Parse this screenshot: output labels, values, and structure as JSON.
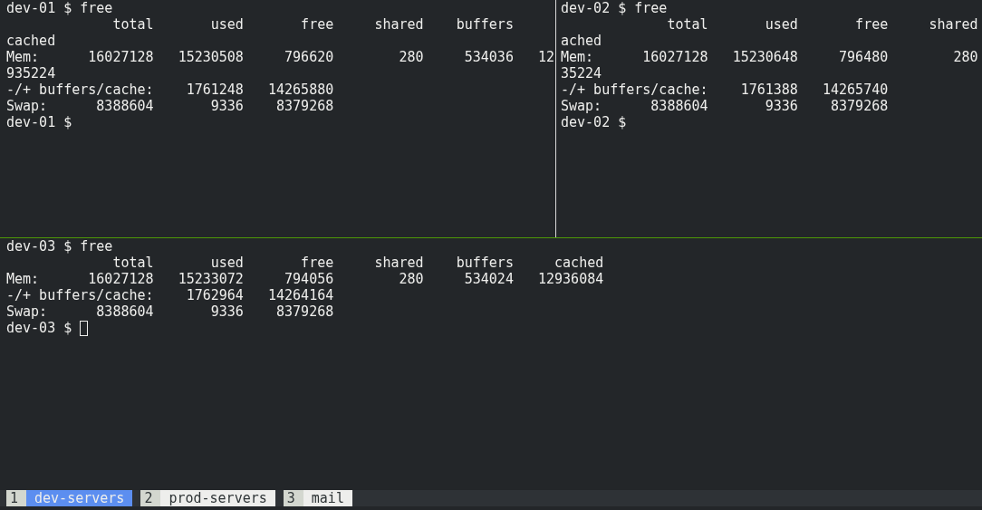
{
  "top_panes": [
    {
      "cursor": false,
      "lines": [
        "dev-01 $ free",
        "             total       used       free     shared    buffers",
        "cached",
        "Mem:      16027128   15230508     796620        280     534036   12",
        "935224",
        "-/+ buffers/cache:    1761248   14265880",
        "Swap:      8388604       9336    8379268",
        "dev-01 $ "
      ]
    },
    {
      "cursor": false,
      "lines": [
        "dev-02 $ free",
        "             total       used       free     shared",
        "ached",
        "Mem:      16027128   15230648     796480        280",
        "35224",
        "-/+ buffers/cache:    1761388   14265740",
        "Swap:      8388604       9336    8379268",
        "dev-02 $ "
      ]
    }
  ],
  "bottom_pane": {
    "cursor": true,
    "lines": [
      "dev-03 $ free",
      "             total       used       free     shared    buffers     cached",
      "Mem:      16027128   15233072     794056        280     534024   12936084",
      "-/+ buffers/cache:    1762964   14264164",
      "Swap:      8388604       9336    8379268",
      "dev-03 $ "
    ]
  },
  "status_bar": {
    "windows": [
      {
        "number": "1",
        "name": "dev-servers",
        "selected": true
      },
      {
        "number": "2",
        "name": "prod-servers",
        "selected": false
      },
      {
        "number": "3",
        "name": "mail",
        "selected": false
      }
    ]
  }
}
